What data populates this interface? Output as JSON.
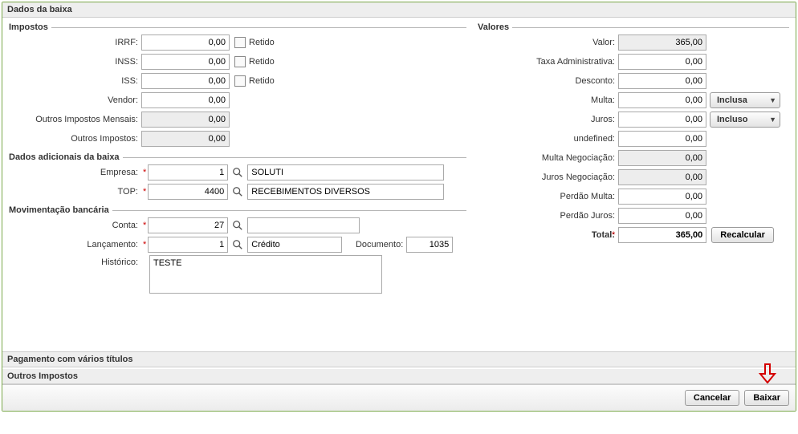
{
  "panel_title": "Dados da baixa",
  "impostos": {
    "legend": "Impostos",
    "irrf_label": "IRRF:",
    "irrf_value": "0,00",
    "irrf_retido": "Retido",
    "inss_label": "INSS:",
    "inss_value": "0,00",
    "inss_retido": "Retido",
    "iss_label": "ISS:",
    "iss_value": "0,00",
    "iss_retido": "Retido",
    "vendor_label": "Vendor:",
    "vendor_value": "0,00",
    "oim_label": "Outros Impostos Mensais:",
    "oim_value": "0,00",
    "oi_label": "Outros Impostos:",
    "oi_value": "0,00"
  },
  "dados_adicionais": {
    "legend": "Dados adicionais da baixa",
    "empresa_label": "Empresa:",
    "empresa_code": "1",
    "empresa_desc": "SOLUTI",
    "top_label": "TOP:",
    "top_code": "4400",
    "top_desc": "RECEBIMENTOS DIVERSOS"
  },
  "mov_bancaria": {
    "legend": "Movimentação bancária",
    "conta_label": "Conta:",
    "conta_code": "27",
    "conta_desc": "",
    "lanc_label": "Lançamento:",
    "lanc_code": "1",
    "lanc_desc": "Crédito",
    "documento_label": "Documento:",
    "documento_value": "1035",
    "historico_label": "Histórico:",
    "historico_value": "TESTE"
  },
  "valores": {
    "legend": "Valores",
    "valor_label": "Valor:",
    "valor_value": "365,00",
    "taxa_label": "Taxa Administrativa:",
    "taxa_value": "0,00",
    "desconto_label": "Desconto:",
    "desconto_value": "0,00",
    "multa_label": "Multa:",
    "multa_value": "0,00",
    "multa_dd": "Inclusa",
    "juros_label": "Juros:",
    "juros_value": "0,00",
    "juros_dd": "Incluso",
    "undef_label": "undefined:",
    "undef_value": "0,00",
    "mneg_label": "Multa Negociação:",
    "mneg_value": "0,00",
    "jneg_label": "Juros Negociação:",
    "jneg_value": "0,00",
    "pmulta_label": "Perdão Multa:",
    "pmulta_value": "0,00",
    "pjuros_label": "Perdão Juros:",
    "pjuros_value": "0,00",
    "total_label": "Total:",
    "total_value": "365,00",
    "recalc": "Recalcular"
  },
  "section_pag": "Pagamento com vários títulos",
  "section_outros": "Outros Impostos",
  "footer": {
    "cancelar": "Cancelar",
    "baixar": "Baixar"
  }
}
